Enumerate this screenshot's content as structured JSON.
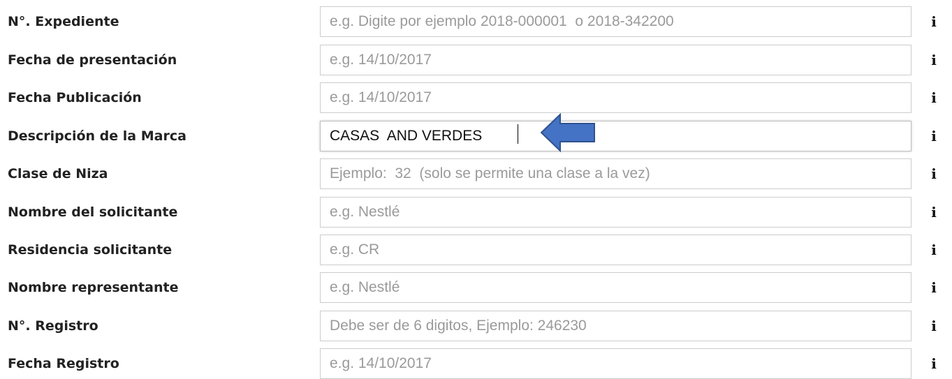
{
  "form": {
    "fields": [
      {
        "label": "N°. Expediente",
        "placeholder": "e.g. Digite por ejemplo 2018-000001  o 2018-342200",
        "value": ""
      },
      {
        "label": "Fecha de presentación",
        "placeholder": "e.g. 14/10/2017",
        "value": ""
      },
      {
        "label": "Fecha Publicación",
        "placeholder": "e.g. 14/10/2017",
        "value": ""
      },
      {
        "label": "Descripción de la Marca",
        "placeholder": "",
        "value": "CASAS  AND VERDES"
      },
      {
        "label": "Clase de Niza",
        "placeholder": "Ejemplo:  32  (solo se permite una clase a la vez)",
        "value": ""
      },
      {
        "label": "Nombre del solicitante",
        "placeholder": "e.g. Nestlé",
        "value": ""
      },
      {
        "label": "Residencia solicitante",
        "placeholder": "e.g. CR",
        "value": ""
      },
      {
        "label": "Nombre representante",
        "placeholder": "e.g. Nestlé",
        "value": ""
      },
      {
        "label": "N°. Registro",
        "placeholder": "Debe ser de 6 digitos, Ejemplo: 246230",
        "value": ""
      },
      {
        "label": "Fecha Registro",
        "placeholder": "e.g. 14/10/2017",
        "value": ""
      }
    ],
    "info_symbol": "i",
    "info_icon": "info-icon"
  },
  "annotation": {
    "arrow_icon": "left-arrow-icon",
    "arrow_color": "#4472c4",
    "arrow_border_color": "#2f528f"
  }
}
